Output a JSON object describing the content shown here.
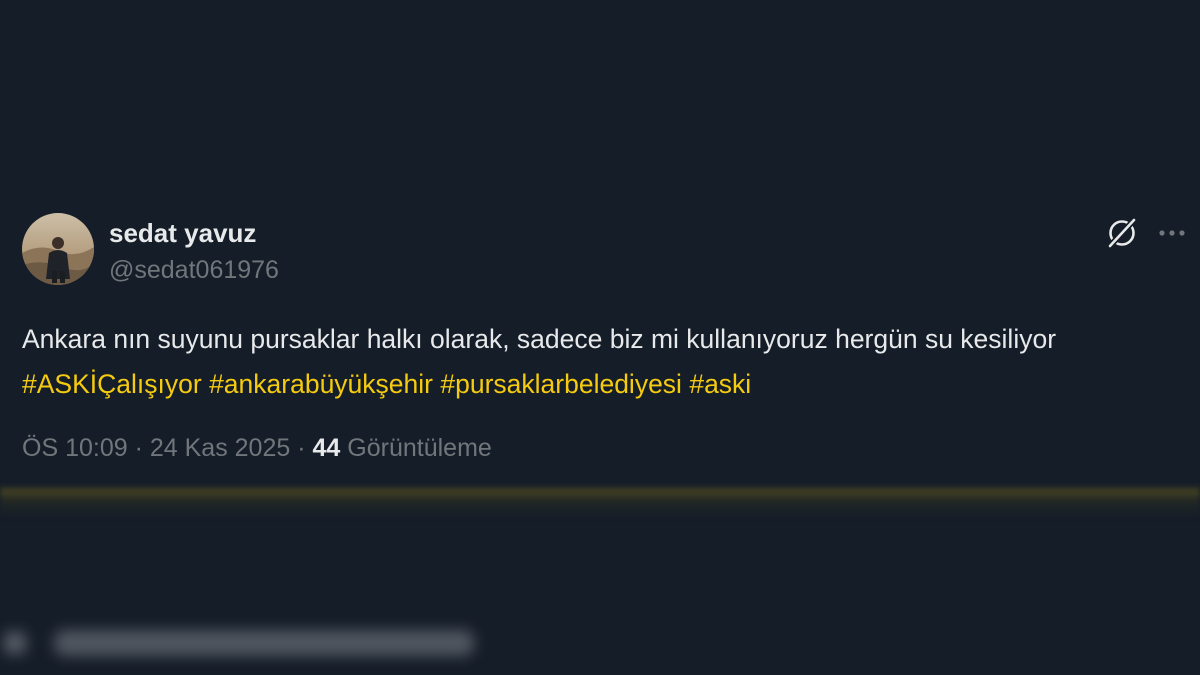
{
  "tweet": {
    "author": {
      "name": "sedat yavuz",
      "handle": "@sedat061976"
    },
    "text_parts": {
      "plain": "Ankara nın suyunu pursaklar halkı olarak, sadece biz mi kullanıyoruz hergün su kesiliyor ",
      "hashtags": [
        "#ASKİÇalışıyor",
        "#ankarabüyükşehir",
        "#pursaklarbelediyesi",
        "#aski"
      ]
    },
    "meta": {
      "time": "ÖS 10:09",
      "separator": "·",
      "date": "24 Kas 2025",
      "views_count": "44",
      "views_label": "Görüntüleme"
    },
    "icons": {
      "grok": "grok-icon",
      "more": "more-icon"
    }
  },
  "colors": {
    "background": "#151d28",
    "text": "#e7e9ea",
    "secondary": "#71767b",
    "hashtag": "#f5cb0f"
  }
}
